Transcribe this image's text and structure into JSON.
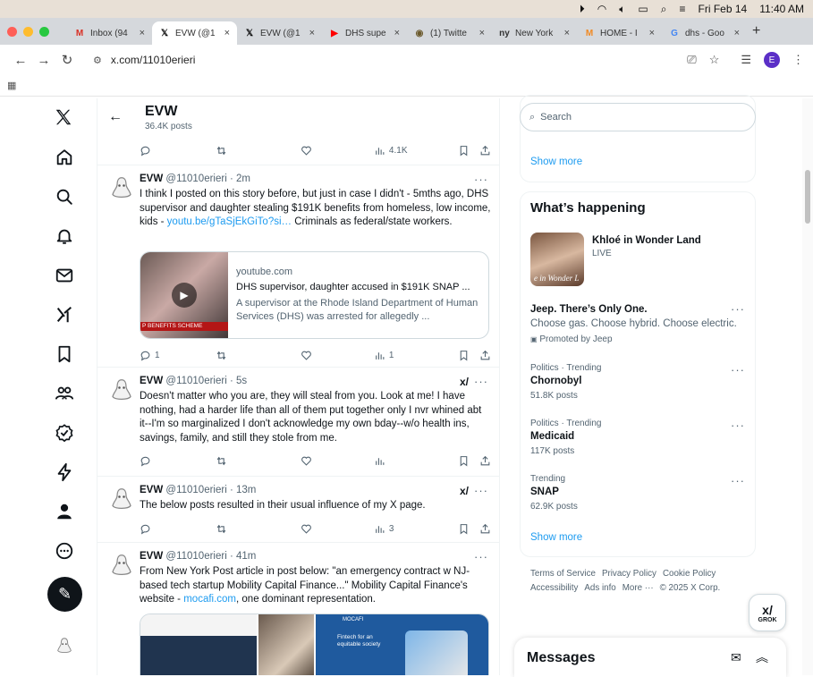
{
  "menubar": {
    "datetime_day": "Fri Feb 14",
    "datetime_time": "11:40 AM"
  },
  "browser": {
    "tabs": [
      {
        "title": "Inbox (94",
        "icon": "gmail-icon",
        "fav": "M",
        "fav_color": "#d93025"
      },
      {
        "title": "EVW (@1",
        "icon": "x-logo-icon",
        "fav": "𝕏",
        "fav_color": "#000000",
        "active": true
      },
      {
        "title": "EVW (@1",
        "icon": "x-logo-icon",
        "fav": "𝕏",
        "fav_color": "#000000"
      },
      {
        "title": "DHS supe",
        "icon": "youtube-icon",
        "fav": "▶",
        "fav_color": "#ff0000"
      },
      {
        "title": "(1) Twitte",
        "icon": "twitter-icon",
        "fav": "◉",
        "fav_color": "#6b5a2c"
      },
      {
        "title": "New York",
        "icon": "nypost-icon",
        "fav": "ny",
        "fav_color": "#333333"
      },
      {
        "title": "HOME - I",
        "icon": "mocafi-icon",
        "fav": "M",
        "fav_color": "#f08a24"
      },
      {
        "title": "dhs - Goo",
        "icon": "google-icon",
        "fav": "G",
        "fav_color": "#4285f4"
      }
    ],
    "url": "x.com/11010erieri",
    "profile_initial": "E"
  },
  "profile": {
    "name": "EVW",
    "posts": "36.4K posts"
  },
  "first_actions": {
    "views": "4.1K"
  },
  "tweets": [
    {
      "name": "EVW",
      "handle": "@11010erieri",
      "time": "· 2m",
      "text_before": "I think I posted on this story before, but just in case I didn't - 5mths ago, DHS supervisor and daughter stealing $191K benefits from homeless, low income, kids - ",
      "link": "youtu.be/gTaSjEkGiTo?si…",
      "text_after": " Criminals as federal/state workers.",
      "card": {
        "domain": "youtube.com",
        "title": "DHS supervisor, daughter accused in $191K SNAP ...",
        "desc": "A supervisor at the Rhode Island Department of Human Services (DHS) was arrested for allegedly ...",
        "banner": "P BENEFITS SCHEME"
      },
      "replies": "1",
      "views": "1"
    },
    {
      "name": "EVW",
      "handle": "@11010erieri",
      "time": "· 5s",
      "text": "Doesn't matter who you are, they will steal from you. Look at me! I have nothing, had a harder life than all of them put together only I nvr whined abt it--I'm so marginalized I don't acknowledge my own bday--w/o health ins, savings, family, and still they stole from me."
    },
    {
      "name": "EVW",
      "handle": "@11010erieri",
      "time": "· 13m",
      "text": "The below posts resulted in their usual influence of my X page.",
      "views": "3"
    },
    {
      "name": "EVW",
      "handle": "@11010erieri",
      "time": "· 41m",
      "text_before": "From New York Post article in post below: \"an emergency contract w NJ-based tech startup Mobility Capital Finance...\" Mobility Capital Finance's website - ",
      "link": "mocafi.com",
      "text_after": ", one dominant representation.",
      "img_caption": "Fintech for an equitable society",
      "img_brand": "MOCAFI"
    }
  ],
  "sidebar": {
    "search_placeholder": "Search",
    "show_more": "Show more",
    "whats_happening": "What’s happening",
    "live": {
      "title": "Khloé in Wonder Land",
      "status": "LIVE",
      "img_text": "e in Wonder L"
    },
    "promo": {
      "title": "Jeep. There’s Only One.",
      "text": "Choose gas. Choose hybrid. Choose electric.",
      "by": "Promoted by Jeep"
    },
    "trends": [
      {
        "category": "Politics · Trending",
        "name": "Chornobyl",
        "count": "51.8K posts"
      },
      {
        "category": "Politics · Trending",
        "name": "Medicaid",
        "count": "117K posts"
      },
      {
        "category": "Trending",
        "name": "SNAP",
        "count": "62.9K posts"
      }
    ],
    "show_more_2": "Show more",
    "footer": [
      "Terms of Service",
      "Privacy Policy",
      "Cookie Policy",
      "Accessibility",
      "Ads info",
      "More ···",
      "© 2025 X Corp."
    ],
    "grok_label": "GROK",
    "messages": "Messages"
  }
}
